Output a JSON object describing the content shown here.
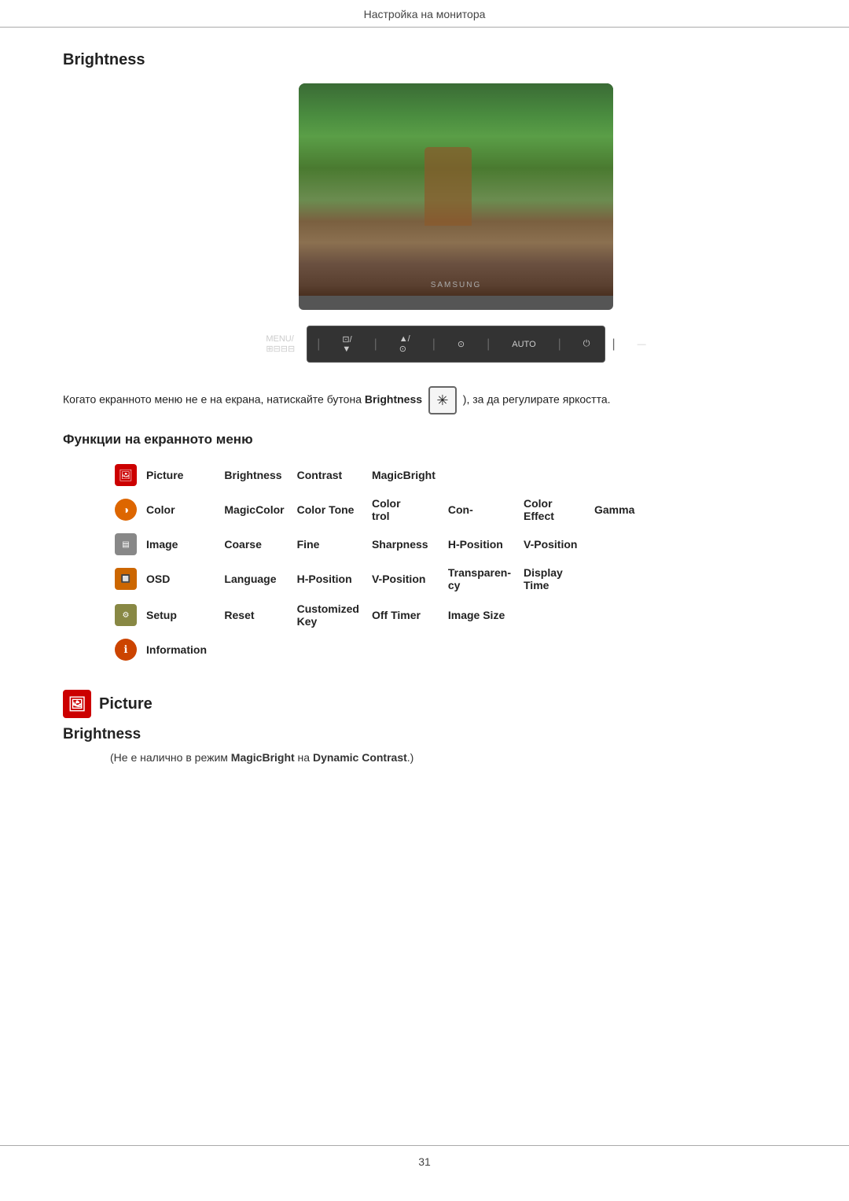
{
  "header": {
    "title": "Настройка на монитора"
  },
  "brightness_section": {
    "title": "Brightness"
  },
  "monitor": {
    "brand": "SAMSUNG",
    "controls": [
      {
        "label": "MENU/⊞⊟⊟⊟"
      },
      {
        "label": "⊡/▼"
      },
      {
        "label": "▲/⊙"
      },
      {
        "label": "⊙"
      },
      {
        "label": "AUTO"
      },
      {
        "label": "⏻"
      },
      {
        "label": "—"
      }
    ]
  },
  "brightness_note": {
    "text_before": "Когато екранното меню не е на екрана, натискайте бутона ",
    "bold": "Brightness",
    "text_after": "), за да регулирате яркостта."
  },
  "submenu": {
    "title": "Функции на екранното меню",
    "rows": [
      {
        "icon": "picture",
        "icon_symbol": "🖼",
        "name": "Picture",
        "items": [
          "Brightness",
          "Contrast",
          "MagicBright"
        ]
      },
      {
        "icon": "color",
        "icon_symbol": "◑",
        "name": "Color",
        "items": [
          "MagicColor",
          "Color Tone",
          "Color trol",
          "Con-",
          "Color Effect",
          "Gamma"
        ]
      },
      {
        "icon": "image",
        "icon_symbol": "⊞",
        "name": "Image",
        "items": [
          "Coarse",
          "Fine",
          "Sharpness",
          "H-Position",
          "V-Position"
        ]
      },
      {
        "icon": "osd",
        "icon_symbol": "⊡",
        "name": "OSD",
        "items": [
          "Language",
          "H-Position",
          "V-Position",
          "Transparen- cy",
          "Display Time"
        ]
      },
      {
        "icon": "setup",
        "icon_symbol": "⚙",
        "name": "Setup",
        "items": [
          "Reset",
          "Customized Key",
          "Off Timer",
          "Image Size"
        ]
      },
      {
        "icon": "info",
        "icon_symbol": "ℹ",
        "name": "Information",
        "items": []
      }
    ]
  },
  "picture_heading": {
    "label": "Picture"
  },
  "brightness_heading": {
    "label": "Brightness"
  },
  "brightness_bottom_note": {
    "text_before": "(Не е налично в режим ",
    "bold1": "MagicBright",
    "text_middle": " на ",
    "bold2": "Dynamic Contrast",
    "text_after": ".)"
  },
  "footer": {
    "page_number": "31"
  }
}
